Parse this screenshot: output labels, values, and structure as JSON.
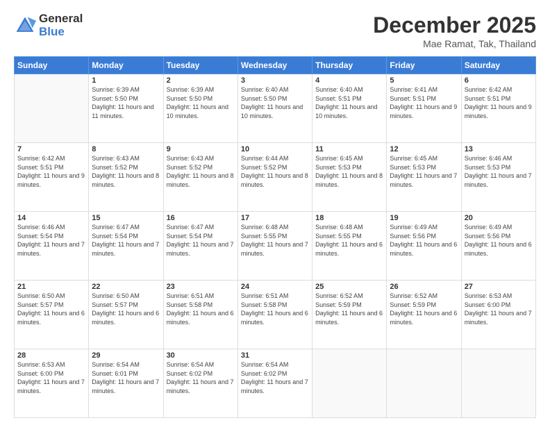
{
  "logo": {
    "general": "General",
    "blue": "Blue"
  },
  "header": {
    "month": "December 2025",
    "location": "Mae Ramat, Tak, Thailand"
  },
  "weekdays": [
    "Sunday",
    "Monday",
    "Tuesday",
    "Wednesday",
    "Thursday",
    "Friday",
    "Saturday"
  ],
  "weeks": [
    [
      {
        "day": "",
        "sunrise": "",
        "sunset": "",
        "daylight": ""
      },
      {
        "day": "1",
        "sunrise": "Sunrise: 6:39 AM",
        "sunset": "Sunset: 5:50 PM",
        "daylight": "Daylight: 11 hours and 11 minutes."
      },
      {
        "day": "2",
        "sunrise": "Sunrise: 6:39 AM",
        "sunset": "Sunset: 5:50 PM",
        "daylight": "Daylight: 11 hours and 10 minutes."
      },
      {
        "day": "3",
        "sunrise": "Sunrise: 6:40 AM",
        "sunset": "Sunset: 5:50 PM",
        "daylight": "Daylight: 11 hours and 10 minutes."
      },
      {
        "day": "4",
        "sunrise": "Sunrise: 6:40 AM",
        "sunset": "Sunset: 5:51 PM",
        "daylight": "Daylight: 11 hours and 10 minutes."
      },
      {
        "day": "5",
        "sunrise": "Sunrise: 6:41 AM",
        "sunset": "Sunset: 5:51 PM",
        "daylight": "Daylight: 11 hours and 9 minutes."
      },
      {
        "day": "6",
        "sunrise": "Sunrise: 6:42 AM",
        "sunset": "Sunset: 5:51 PM",
        "daylight": "Daylight: 11 hours and 9 minutes."
      }
    ],
    [
      {
        "day": "7",
        "sunrise": "Sunrise: 6:42 AM",
        "sunset": "Sunset: 5:51 PM",
        "daylight": "Daylight: 11 hours and 9 minutes."
      },
      {
        "day": "8",
        "sunrise": "Sunrise: 6:43 AM",
        "sunset": "Sunset: 5:52 PM",
        "daylight": "Daylight: 11 hours and 8 minutes."
      },
      {
        "day": "9",
        "sunrise": "Sunrise: 6:43 AM",
        "sunset": "Sunset: 5:52 PM",
        "daylight": "Daylight: 11 hours and 8 minutes."
      },
      {
        "day": "10",
        "sunrise": "Sunrise: 6:44 AM",
        "sunset": "Sunset: 5:52 PM",
        "daylight": "Daylight: 11 hours and 8 minutes."
      },
      {
        "day": "11",
        "sunrise": "Sunrise: 6:45 AM",
        "sunset": "Sunset: 5:53 PM",
        "daylight": "Daylight: 11 hours and 8 minutes."
      },
      {
        "day": "12",
        "sunrise": "Sunrise: 6:45 AM",
        "sunset": "Sunset: 5:53 PM",
        "daylight": "Daylight: 11 hours and 7 minutes."
      },
      {
        "day": "13",
        "sunrise": "Sunrise: 6:46 AM",
        "sunset": "Sunset: 5:53 PM",
        "daylight": "Daylight: 11 hours and 7 minutes."
      }
    ],
    [
      {
        "day": "14",
        "sunrise": "Sunrise: 6:46 AM",
        "sunset": "Sunset: 5:54 PM",
        "daylight": "Daylight: 11 hours and 7 minutes."
      },
      {
        "day": "15",
        "sunrise": "Sunrise: 6:47 AM",
        "sunset": "Sunset: 5:54 PM",
        "daylight": "Daylight: 11 hours and 7 minutes."
      },
      {
        "day": "16",
        "sunrise": "Sunrise: 6:47 AM",
        "sunset": "Sunset: 5:54 PM",
        "daylight": "Daylight: 11 hours and 7 minutes."
      },
      {
        "day": "17",
        "sunrise": "Sunrise: 6:48 AM",
        "sunset": "Sunset: 5:55 PM",
        "daylight": "Daylight: 11 hours and 7 minutes."
      },
      {
        "day": "18",
        "sunrise": "Sunrise: 6:48 AM",
        "sunset": "Sunset: 5:55 PM",
        "daylight": "Daylight: 11 hours and 6 minutes."
      },
      {
        "day": "19",
        "sunrise": "Sunrise: 6:49 AM",
        "sunset": "Sunset: 5:56 PM",
        "daylight": "Daylight: 11 hours and 6 minutes."
      },
      {
        "day": "20",
        "sunrise": "Sunrise: 6:49 AM",
        "sunset": "Sunset: 5:56 PM",
        "daylight": "Daylight: 11 hours and 6 minutes."
      }
    ],
    [
      {
        "day": "21",
        "sunrise": "Sunrise: 6:50 AM",
        "sunset": "Sunset: 5:57 PM",
        "daylight": "Daylight: 11 hours and 6 minutes."
      },
      {
        "day": "22",
        "sunrise": "Sunrise: 6:50 AM",
        "sunset": "Sunset: 5:57 PM",
        "daylight": "Daylight: 11 hours and 6 minutes."
      },
      {
        "day": "23",
        "sunrise": "Sunrise: 6:51 AM",
        "sunset": "Sunset: 5:58 PM",
        "daylight": "Daylight: 11 hours and 6 minutes."
      },
      {
        "day": "24",
        "sunrise": "Sunrise: 6:51 AM",
        "sunset": "Sunset: 5:58 PM",
        "daylight": "Daylight: 11 hours and 6 minutes."
      },
      {
        "day": "25",
        "sunrise": "Sunrise: 6:52 AM",
        "sunset": "Sunset: 5:59 PM",
        "daylight": "Daylight: 11 hours and 6 minutes."
      },
      {
        "day": "26",
        "sunrise": "Sunrise: 6:52 AM",
        "sunset": "Sunset: 5:59 PM",
        "daylight": "Daylight: 11 hours and 6 minutes."
      },
      {
        "day": "27",
        "sunrise": "Sunrise: 6:53 AM",
        "sunset": "Sunset: 6:00 PM",
        "daylight": "Daylight: 11 hours and 7 minutes."
      }
    ],
    [
      {
        "day": "28",
        "sunrise": "Sunrise: 6:53 AM",
        "sunset": "Sunset: 6:00 PM",
        "daylight": "Daylight: 11 hours and 7 minutes."
      },
      {
        "day": "29",
        "sunrise": "Sunrise: 6:54 AM",
        "sunset": "Sunset: 6:01 PM",
        "daylight": "Daylight: 11 hours and 7 minutes."
      },
      {
        "day": "30",
        "sunrise": "Sunrise: 6:54 AM",
        "sunset": "Sunset: 6:02 PM",
        "daylight": "Daylight: 11 hours and 7 minutes."
      },
      {
        "day": "31",
        "sunrise": "Sunrise: 6:54 AM",
        "sunset": "Sunset: 6:02 PM",
        "daylight": "Daylight: 11 hours and 7 minutes."
      },
      {
        "day": "",
        "sunrise": "",
        "sunset": "",
        "daylight": ""
      },
      {
        "day": "",
        "sunrise": "",
        "sunset": "",
        "daylight": ""
      },
      {
        "day": "",
        "sunrise": "",
        "sunset": "",
        "daylight": ""
      }
    ]
  ]
}
